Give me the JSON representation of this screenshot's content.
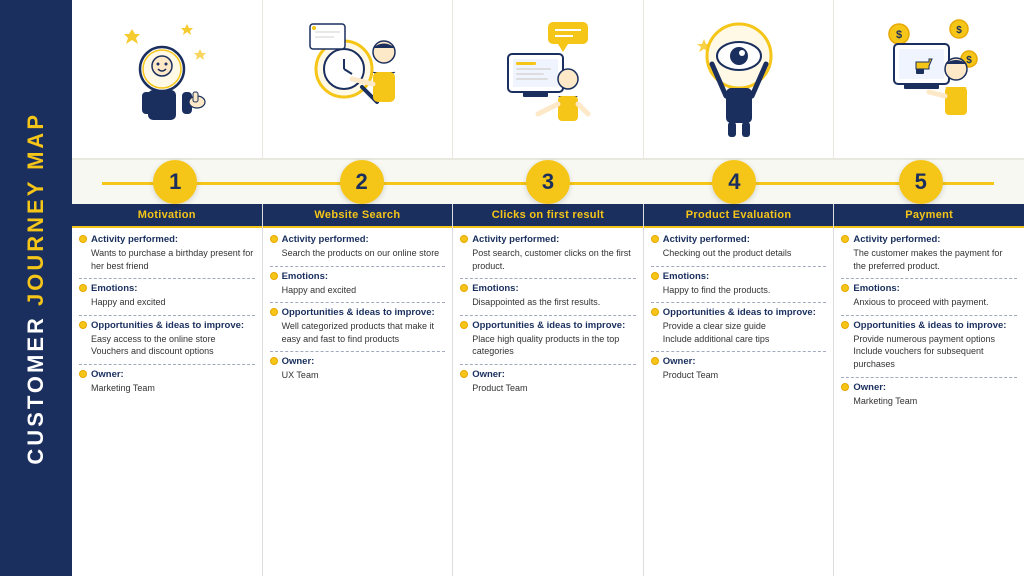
{
  "sidebar": {
    "line1": "CUSTOMER",
    "line2": "JOURNEY MAP"
  },
  "steps": [
    "1",
    "2",
    "3",
    "4",
    "5"
  ],
  "columns": [
    {
      "header": "Motivation",
      "activity_title": "Activity performed:",
      "activity_body": "Wants to purchase a birthday present for her best friend",
      "emotions_title": "Emotions:",
      "emotions_body": "Happy and excited",
      "opportunities_title": "Opportunities & ideas to improve:",
      "opportunities_body": "Easy access to the online store\nVouchers and discount options",
      "owner_title": "Owner:",
      "owner_body": "Marketing Team"
    },
    {
      "header": "Website Search",
      "activity_title": "Activity performed:",
      "activity_body": "Search the products on our online store",
      "emotions_title": "Emotions:",
      "emotions_body": "Happy and excited",
      "opportunities_title": "Opportunities & ideas to improve:",
      "opportunities_body": "Well categorized products that make it easy and fast to find products",
      "owner_title": "Owner:",
      "owner_body": "UX Team"
    },
    {
      "header": "Clicks on first result",
      "activity_title": "Activity performed:",
      "activity_body": "Post search, customer clicks on the first product.",
      "emotions_title": "Emotions:",
      "emotions_body": "Disappointed as the first results.",
      "opportunities_title": "Opportunities & ideas to improve:",
      "opportunities_body": "Place high quality products in the top categories",
      "owner_title": "Owner:",
      "owner_body": "Product Team"
    },
    {
      "header": "Product Evaluation",
      "activity_title": "Activity performed:",
      "activity_body": "Checking out the product details",
      "emotions_title": "Emotions:",
      "emotions_body": "Happy to find the products.",
      "opportunities_title": "Opportunities & ideas to improve:",
      "opportunities_body": "Provide a clear size guide\nInclude additional care tips",
      "owner_title": "Owner:",
      "owner_body": "Product Team"
    },
    {
      "header": "Payment",
      "activity_title": "Activity performed:",
      "activity_body": "The customer makes the payment for the preferred product.",
      "emotions_title": "Emotions:",
      "emotions_body": "Anxious to proceed with payment.",
      "opportunities_title": "Opportunities & ideas to improve:",
      "opportunities_body": "Provide numerous payment options\nInclude vouchers for subsequent purchases",
      "owner_title": "Owner:",
      "owner_body": "Marketing Team"
    }
  ]
}
